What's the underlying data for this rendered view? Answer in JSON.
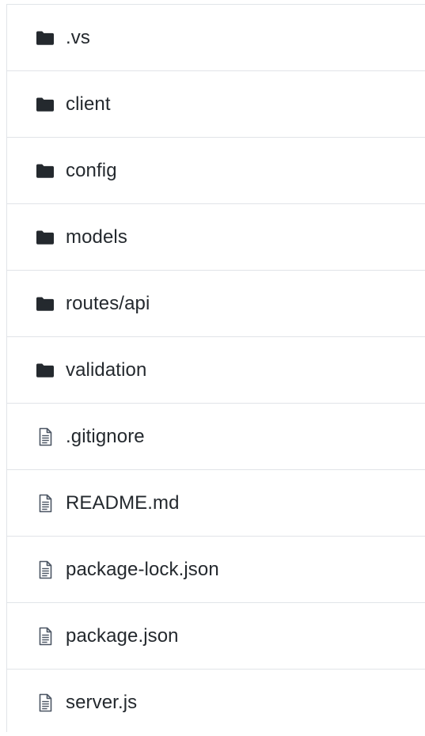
{
  "colors": {
    "text": "#24292e",
    "folder_icon": "#24292e",
    "file_icon": "#4b5563",
    "divider": "#e1e4e8",
    "background": "#ffffff"
  },
  "entries": [
    {
      "name": ".vs",
      "type": "folder",
      "icon": "folder-icon"
    },
    {
      "name": "client",
      "type": "folder",
      "icon": "folder-icon"
    },
    {
      "name": "config",
      "type": "folder",
      "icon": "folder-icon"
    },
    {
      "name": "models",
      "type": "folder",
      "icon": "folder-icon"
    },
    {
      "name": "routes/api",
      "type": "folder",
      "icon": "folder-icon"
    },
    {
      "name": "validation",
      "type": "folder",
      "icon": "folder-icon"
    },
    {
      "name": ".gitignore",
      "type": "file",
      "icon": "file-icon"
    },
    {
      "name": "README.md",
      "type": "file",
      "icon": "file-icon"
    },
    {
      "name": "package-lock.json",
      "type": "file",
      "icon": "file-icon"
    },
    {
      "name": "package.json",
      "type": "file",
      "icon": "file-icon"
    },
    {
      "name": "server.js",
      "type": "file",
      "icon": "file-icon"
    }
  ]
}
